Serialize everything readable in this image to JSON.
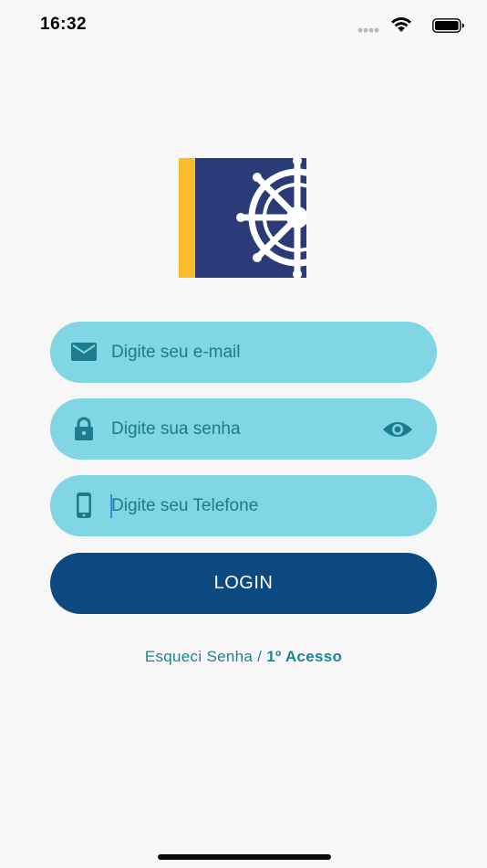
{
  "status_bar": {
    "time": "16:32",
    "signal_icon": "signal-dots-icon",
    "wifi_icon": "wifi-icon",
    "battery_icon": "battery-icon"
  },
  "logo": {
    "icon": "ship-wheel-logo",
    "colors": {
      "stripe": "#fbbd2b",
      "background": "#2b3b78",
      "wheel": "#ffffff"
    }
  },
  "form": {
    "email": {
      "placeholder": "Digite seu e-mail",
      "value": "",
      "icon": "envelope-icon"
    },
    "password": {
      "placeholder": "Digite sua senha",
      "value": "",
      "icon": "lock-icon",
      "toggle_icon": "eye-icon"
    },
    "phone": {
      "placeholder": "Digite seu Telefone",
      "value": "",
      "icon": "smartphone-icon"
    },
    "field_color": "#80d6e2",
    "icon_color": "#1a7c8c"
  },
  "login_button": {
    "label": "LOGIN",
    "color": "#0b4980"
  },
  "links": {
    "forgot_password": "Esqueci Senha",
    "separator": " / ",
    "first_access": "1º Acesso"
  }
}
